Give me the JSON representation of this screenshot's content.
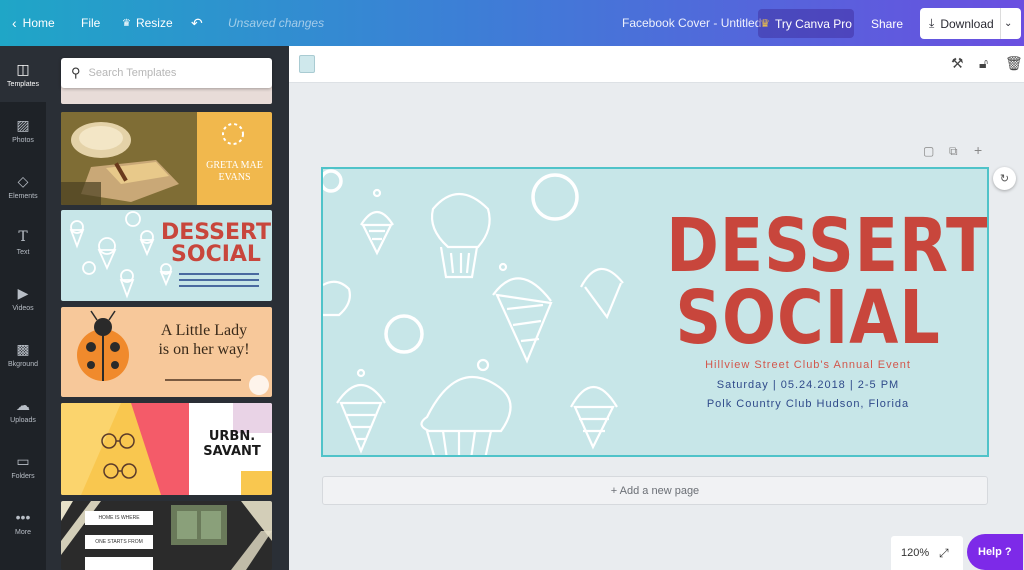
{
  "topbar": {
    "home": "Home",
    "file": "File",
    "resize": "Resize",
    "status": "Unsaved changes",
    "doc_title": "Facebook Cover - Untitled",
    "try_pro": "Try Canva Pro",
    "share": "Share",
    "download": "Download",
    "gradient_colors": [
      "#1fa6c7",
      "#3c7fd6",
      "#6a4fe0"
    ]
  },
  "rail": {
    "items": [
      {
        "label": "Templates",
        "icon": "templates-icon"
      },
      {
        "label": "Photos",
        "icon": "photos-icon"
      },
      {
        "label": "Elements",
        "icon": "elements-icon"
      },
      {
        "label": "Text",
        "icon": "text-icon"
      },
      {
        "label": "Videos",
        "icon": "videos-icon"
      },
      {
        "label": "Bkground",
        "icon": "background-icon"
      },
      {
        "label": "Uploads",
        "icon": "uploads-icon"
      },
      {
        "label": "Folders",
        "icon": "folders-icon"
      },
      {
        "label": "More",
        "icon": "more-icon"
      }
    ]
  },
  "panel": {
    "search_placeholder": "Search Templates",
    "templates": [
      {
        "name": "Greta Mae Evans",
        "line1": "GRETA MAE",
        "line2": "EVANS"
      },
      {
        "name": "Dessert Social",
        "line1": "DESSERT",
        "line2": "SOCIAL"
      },
      {
        "name": "A Little Lady",
        "line1": "A Little Lady",
        "line2": "is on her way!"
      },
      {
        "name": "URBN. SAVANT",
        "line1": "URBN.",
        "line2": "SAVANT"
      },
      {
        "name": "Home is where",
        "line1": "HOME IS WHERE",
        "line2": "ONE STARTS FROM"
      }
    ]
  },
  "design": {
    "title_line1": "DESSERT",
    "title_line2": "SOCIAL",
    "subtitle": "Hillview Street Club's Annual Event",
    "date_line": "Saturday | 05.24.2018 | 2-5 PM",
    "location": "Polk Country Club Hudson, Florida",
    "background_color": "#c7e6e8",
    "title_color": "#c8463c",
    "text_color": "#2f4a8a"
  },
  "stage": {
    "add_page": "+ Add a new page",
    "zoom": "120%",
    "help": "Help ?"
  }
}
